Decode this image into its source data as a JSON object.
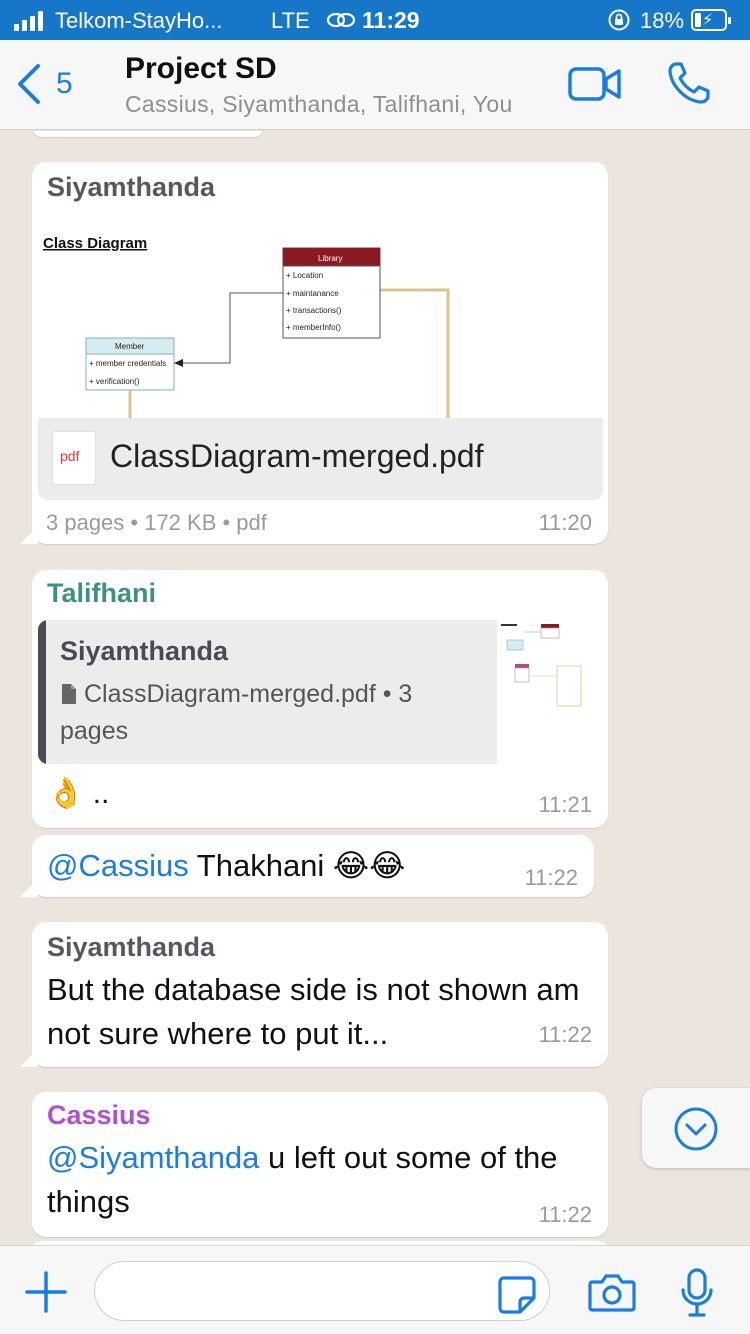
{
  "status_bar": {
    "carrier": "Telkom-StayHo...",
    "network": "LTE",
    "time": "11:29",
    "battery_pct": "18%",
    "battery_level": 0.18
  },
  "header": {
    "back_count": "5",
    "title": "Project SD",
    "subtitle": "Cassius, Siyamthanda, Talifhani, You"
  },
  "messages": [
    {
      "sender": "Siyamthanda",
      "sender_color": "#5b5561",
      "doc_name": "ClassDiagram-merged.pdf",
      "pdf_label": "pdf",
      "doc_meta": "3 pages • 172 KB • pdf",
      "time": "11:20",
      "preview": {
        "heading": "Class Diagram",
        "library_title": "Library",
        "library_items": [
          "+ Location",
          "+ maintanance",
          "+ transactions()",
          "+ memberInfo()"
        ],
        "member_title": "Member",
        "member_items": [
          "+ member credentials",
          "+ verification()"
        ]
      }
    },
    {
      "sender": "Talifhani",
      "sender_color": "#3f8f86",
      "quote_sender": "Siyamthanda",
      "quote_text": "ClassDiagram-merged.pdf • 3 pages",
      "text": "👌 ..",
      "time": "11:21"
    },
    {
      "mention": "@Cassius",
      "text": " Thakhani 😂😂",
      "time": "11:22"
    },
    {
      "sender": "Siyamthanda",
      "sender_color": "#5b5561",
      "text": "But the database side is not shown am not sure where to put it...",
      "time": "11:22"
    },
    {
      "sender": "Cassius",
      "sender_color": "#b14fd1",
      "mention": "@Siyamthanda",
      "text": " u left out some of the things",
      "time": "11:22"
    }
  ],
  "colors": {
    "accent": "#1a7de2",
    "status_bar": "#1677c9",
    "chat_bg": "#ece5dd"
  }
}
